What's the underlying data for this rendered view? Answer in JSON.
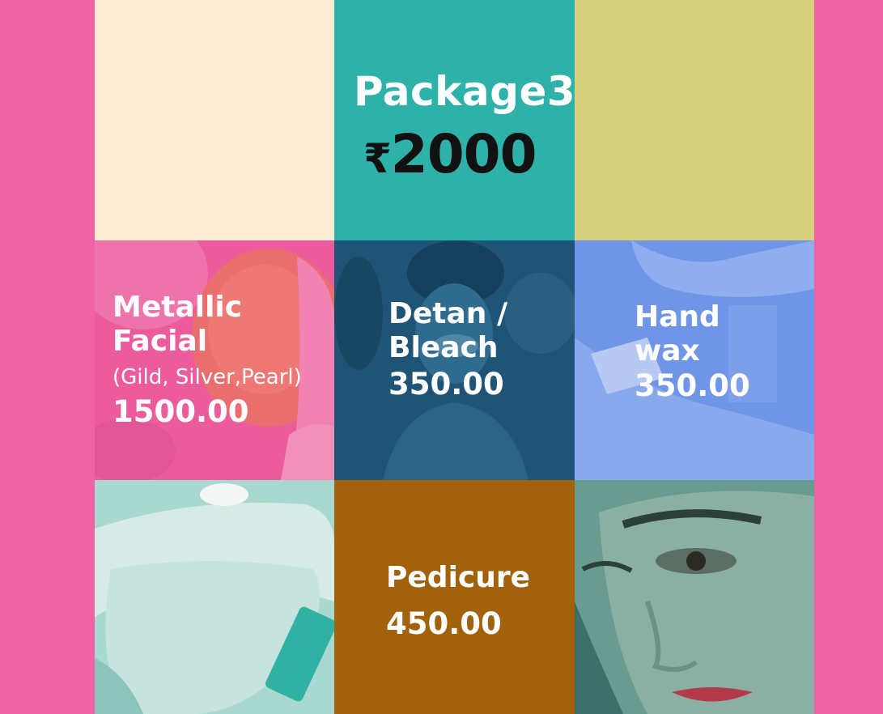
{
  "package": {
    "title": "Package3",
    "currency": "₹",
    "price": "2000"
  },
  "services": {
    "metallic_facial": {
      "name_line1": "Metallic",
      "name_line2": "Facial",
      "subtitle": "(Gild, Silver,Pearl)",
      "price": "1500.00"
    },
    "detan_bleach": {
      "name_line1": "Detan /",
      "name_line2": "Bleach",
      "price": "350.00"
    },
    "hand_wax": {
      "name_line1": "Hand",
      "name_line2": "wax",
      "price": "350.00"
    },
    "pedicure": {
      "name": "Pedicure",
      "price": "450.00"
    }
  },
  "colors": {
    "background": "#f062a4",
    "cream": "#fdebd3",
    "teal": "#2db1a9",
    "olive": "#d6d07f",
    "pink_overlay": "#ec5c9d",
    "navy_overlay": "#1f5476",
    "blue_overlay": "#6f95e6",
    "brown": "#a2610b"
  },
  "images": {
    "tile_metallic_facial": "woman-facial-mask-photo",
    "tile_detan": "woman-face-treatment-photo",
    "tile_hand_wax": "hand-waxing-photo",
    "tile_feet": "foot-care-photo",
    "tile_eye_makeup": "woman-eye-makeup-photo"
  }
}
